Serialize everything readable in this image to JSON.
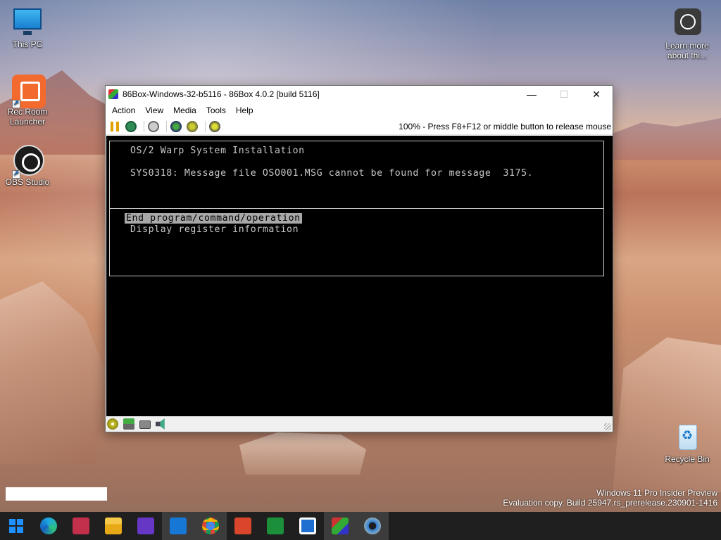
{
  "desktop": {
    "icons": [
      {
        "label": "This PC"
      },
      {
        "label": "Rec Room Launcher"
      },
      {
        "label": "OBS Studio"
      },
      {
        "label": "Learn more about thi..."
      },
      {
        "label": "Recycle Bin"
      }
    ],
    "watermark": {
      "line1": "Windows 11 Pro Insider Preview",
      "line2": "Evaluation copy. Build 25947.rs_prerelease.230901-1416"
    }
  },
  "window": {
    "title": "86Box-Windows-32-b5116 - 86Box 4.0.2 [build 5116]",
    "controls": {
      "minimize": "—",
      "maximize": "☐",
      "close": "✕"
    },
    "menu": [
      "Action",
      "View",
      "Media",
      "Tools",
      "Help"
    ],
    "toolbar": {
      "icons": [
        "pause-icon",
        "reset-icon",
        "power-icon",
        "ctrl-alt-del-icon",
        "ctrl-alt-esc-icon",
        "settings-icon"
      ],
      "status": "100% - Press F8+F12 or middle button to release mouse"
    },
    "screen": {
      "title": "OS/2 Warp System Installation",
      "message": "SYS0318: Message file OSO001.MSG cannot be found for message  3175.",
      "options": [
        "End program/command/operation",
        "Display register information"
      ],
      "selected_index": 0
    },
    "statusbar_icons": [
      "cdrom-icon",
      "network-icon",
      "hard-disk-icon",
      "sound-icon"
    ]
  },
  "taskbar": {
    "apps": [
      "start",
      "edge-beta",
      "news",
      "file-explorer",
      "app-purple",
      "app-blue",
      "chrome",
      "app-orange",
      "calculator",
      "photos",
      "86box",
      "settings"
    ]
  }
}
